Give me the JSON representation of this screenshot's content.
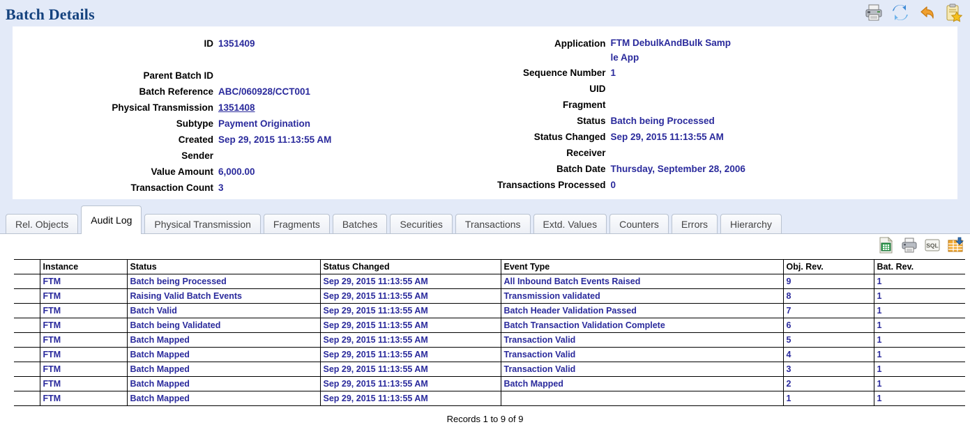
{
  "header": {
    "title": "Batch Details",
    "icons": [
      {
        "name": "print-icon",
        "label": "Print"
      },
      {
        "name": "refresh-icon",
        "label": "Refresh"
      },
      {
        "name": "back-icon",
        "label": "Back"
      },
      {
        "name": "add-to-favorites-icon",
        "label": "Add to favorites"
      }
    ]
  },
  "details": {
    "left": [
      {
        "label": "ID",
        "value": "1351409",
        "link": false
      },
      {
        "label": "",
        "value": "",
        "link": false
      },
      {
        "label": "Parent Batch ID",
        "value": "",
        "link": false
      },
      {
        "label": "Batch Reference",
        "value": "ABC/060928/CCT001",
        "link": false
      },
      {
        "label": "Physical Transmission",
        "value": "1351408",
        "link": true
      },
      {
        "label": "Subtype",
        "value": "Payment Origination",
        "link": false
      },
      {
        "label": "Created",
        "value": "Sep 29, 2015 11:13:55 AM",
        "link": false
      },
      {
        "label": "Sender",
        "value": "",
        "link": false
      },
      {
        "label": "Value Amount",
        "value": "6,000.00",
        "link": false
      },
      {
        "label": "Transaction Count",
        "value": "3",
        "link": false
      }
    ],
    "right": [
      {
        "label": "Application",
        "value": "FTM DebulkAndBulk Samp le App",
        "link": false,
        "wrap": true
      },
      {
        "label": "Sequence Number",
        "value": "1",
        "link": false
      },
      {
        "label": "UID",
        "value": "",
        "link": false
      },
      {
        "label": "Fragment",
        "value": "",
        "link": false
      },
      {
        "label": "Status",
        "value": "Batch being Processed",
        "link": false
      },
      {
        "label": "Status Changed",
        "value": "Sep 29, 2015 11:13:55 AM",
        "link": false
      },
      {
        "label": "Receiver",
        "value": "",
        "link": false
      },
      {
        "label": "Batch Date",
        "value": "Thursday, September 28, 2006",
        "link": false
      },
      {
        "label": "Transactions Processed",
        "value": "0",
        "link": false
      }
    ]
  },
  "tabs": [
    {
      "label": "Rel. Objects",
      "active": false
    },
    {
      "label": "Audit Log",
      "active": true
    },
    {
      "label": "Physical Transmission",
      "active": false
    },
    {
      "label": "Fragments",
      "active": false
    },
    {
      "label": "Batches",
      "active": false
    },
    {
      "label": "Securities",
      "active": false
    },
    {
      "label": "Transactions",
      "active": false
    },
    {
      "label": "Extd. Values",
      "active": false
    },
    {
      "label": "Counters",
      "active": false
    },
    {
      "label": "Errors",
      "active": false
    },
    {
      "label": "Hierarchy",
      "active": false
    }
  ],
  "grid_toolbar": [
    {
      "name": "export-excel-icon",
      "label": "Export to spreadsheet"
    },
    {
      "name": "print-icon",
      "label": "Print"
    },
    {
      "name": "sql-icon",
      "label": "Show SQL"
    },
    {
      "name": "export-table-icon",
      "label": "Download table"
    }
  ],
  "table": {
    "columns": [
      "",
      "Instance",
      "Status",
      "Status Changed",
      "Event Type",
      "Obj. Rev.",
      "Bat. Rev."
    ],
    "rows": [
      [
        "",
        "FTM",
        "Batch being Processed",
        "Sep 29, 2015 11:13:55 AM",
        "All Inbound Batch Events Raised",
        "9",
        "1"
      ],
      [
        "",
        "FTM",
        "Raising Valid Batch Events",
        "Sep 29, 2015 11:13:55 AM",
        "Transmission validated",
        "8",
        "1"
      ],
      [
        "",
        "FTM",
        "Batch Valid",
        "Sep 29, 2015 11:13:55 AM",
        "Batch Header Validation Passed",
        "7",
        "1"
      ],
      [
        "",
        "FTM",
        "Batch being Validated",
        "Sep 29, 2015 11:13:55 AM",
        "Batch Transaction Validation Complete",
        "6",
        "1"
      ],
      [
        "",
        "FTM",
        "Batch Mapped",
        "Sep 29, 2015 11:13:55 AM",
        "Transaction Valid",
        "5",
        "1"
      ],
      [
        "",
        "FTM",
        "Batch Mapped",
        "Sep 29, 2015 11:13:55 AM",
        "Transaction Valid",
        "4",
        "1"
      ],
      [
        "",
        "FTM",
        "Batch Mapped",
        "Sep 29, 2015 11:13:55 AM",
        "Transaction Valid",
        "3",
        "1"
      ],
      [
        "",
        "FTM",
        "Batch Mapped",
        "Sep 29, 2015 11:13:55 AM",
        "Batch Mapped",
        "2",
        "1"
      ],
      [
        "",
        "FTM",
        "Batch Mapped",
        "Sep 29, 2015 11:13:55 AM",
        "",
        "1",
        "1"
      ]
    ],
    "footer": "Records 1 to 9 of 9"
  },
  "colors": {
    "page_bg": "#e3eaf8",
    "title": "#14427e",
    "value": "#2a2a9c",
    "panel": "#ffffff"
  }
}
